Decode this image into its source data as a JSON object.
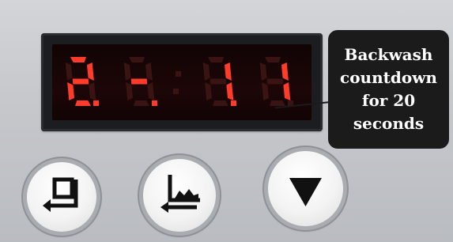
{
  "display": {
    "digits": [
      "2.",
      "-.",
      ":",
      "1.",
      "1"
    ],
    "segment_color": "#ff3b2a",
    "dim_segment_color": "#3a1412"
  },
  "callout": {
    "text": "Backwash\ncountdown\nfor 20\nseconds"
  },
  "buttons": [
    {
      "icon": "return-icon"
    },
    {
      "icon": "chart-return-icon"
    },
    {
      "icon": "down-arrow-icon"
    }
  ]
}
